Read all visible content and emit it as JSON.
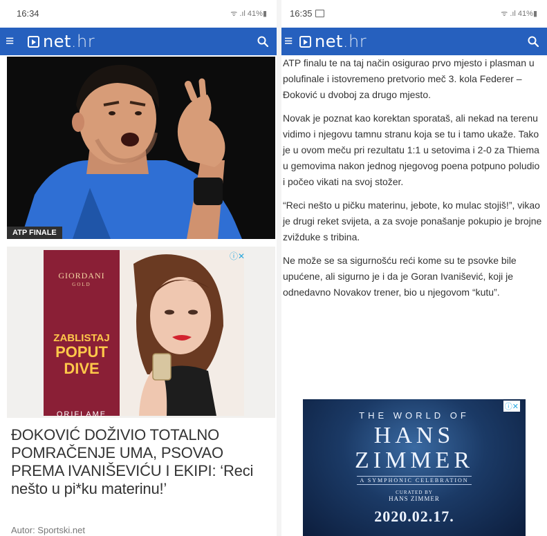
{
  "left": {
    "status": {
      "time": "16:34",
      "system": "ᯤ .ıl 41%▮"
    },
    "hero": {
      "tag": "ATP FINALE"
    },
    "ad": {
      "choices": "ⓘ✕",
      "brand": "GIORDANI",
      "brand_sub": "GOLD",
      "slogan_1": "ZABLISTAJ",
      "slogan_2": "POPUT",
      "slogan_3": "DIVE",
      "brand2": "ORIFLAME"
    },
    "headline": "ĐOKOVIĆ DOŽIVIO TOTALNO POMRAČENJE UMA, PSOVAO PREMA IVANIŠEVIĆU I EKIPI: ‘Reci nešto u pi*ku materinu!’",
    "author": "Autor: Sportski.net"
  },
  "right": {
    "status": {
      "time": "16:35",
      "system": "ᯤ .ıl 41%▮"
    },
    "paragraphs": [
      "ATP finalu te na taj način osigurao prvo mjesto i plasman u polufinale i istovremeno pretvorio meč 3. kola Federer – Đoković u dvoboj za drugo mjesto.",
      "Novak je poznat kao korektan sporataš, ali nekad na terenu vidimo i njegovu tamnu stranu koja se tu i tamo ukaže. Tako je u ovom meču pri rezultatu 1:1 u setovima i 2-0 za Thiema u gemovima nakon jednog njegovog poena potpuno poludio i počeo vikati na svoj stožer.",
      "“Reci nešto u pičku materinu, jebote, ko mulac stojiš!”, vikao je drugi reket svijeta, a za svoje ponašanje pokupio je brojne zvižduke s tribina.",
      "Ne može se sa sigurnošću reći kome su te psovke bile upućene, ali sigurno je i da je Goran Ivanišević, koji je odnedavno Novakov trener, bio u njegovom “kutu”."
    ],
    "ad": {
      "choices": "ⓘ✕",
      "kicker": "THE WORLD OF",
      "title_1": "HANS",
      "title_2": "ZIMMER",
      "subtitle": "A SYMPHONIC CELEBRATION",
      "curated": "CURATED BY",
      "curator": "HANS ZIMMER",
      "date": "2020.02.17."
    }
  },
  "navbar": {
    "logo": "net.hr",
    "color": "#2660be"
  }
}
